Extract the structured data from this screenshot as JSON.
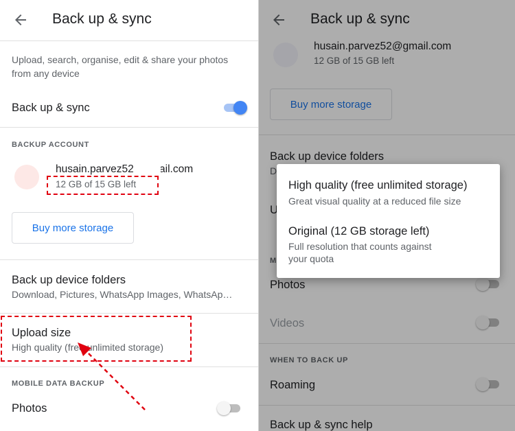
{
  "left": {
    "header": {
      "title": "Back up & sync"
    },
    "description": "Upload, search, organise, edit & share your photos from any device",
    "backup_sync": {
      "label": "Back up & sync",
      "enabled": true
    },
    "backup_account": {
      "section_title": "BACKUP ACCOUNT",
      "email": "husain.parvez52@gmail.com",
      "storage_left": "12 GB of 15 GB left",
      "buy_storage": "Buy more storage"
    },
    "device_folders": {
      "title": "Back up device folders",
      "value": "Download, Pictures, WhatsApp Images, WhatsAp…"
    },
    "upload_size": {
      "title": "Upload size",
      "value": "High quality (free unlimited storage)"
    },
    "mobile_data": {
      "section_title": "MOBILE DATA BACKUP",
      "photos_label": "Photos",
      "photos_enabled": false
    }
  },
  "right": {
    "header": {
      "title": "Back up & sync"
    },
    "account": {
      "email": "husain.parvez52@gmail.com",
      "storage_left": "12 GB of 15 GB left",
      "buy_storage": "Buy more storage"
    },
    "device_folders": {
      "title": "Back up device folders",
      "value_partial": "D"
    },
    "upload_partial": "U",
    "mobile_partial": "M",
    "photos": {
      "label": "Photos",
      "enabled": false
    },
    "videos": {
      "label": "Videos",
      "enabled": false
    },
    "when_to_back_up": {
      "section_title": "WHEN TO BACK UP",
      "roaming_label": "Roaming",
      "roaming_enabled": false
    },
    "help": "Back up & sync help",
    "dialog": {
      "options": [
        {
          "title": "High quality (free unlimited storage)",
          "subtitle": "Great visual quality at a reduced file size"
        },
        {
          "title": "Original (12 GB storage left)",
          "subtitle_line1": "Full resolution that counts against",
          "subtitle_line2": "your quota"
        }
      ]
    }
  },
  "colors": {
    "accent": "#1a73e8",
    "toggle_on": "#4285f4",
    "annotation": "#e0000f"
  }
}
